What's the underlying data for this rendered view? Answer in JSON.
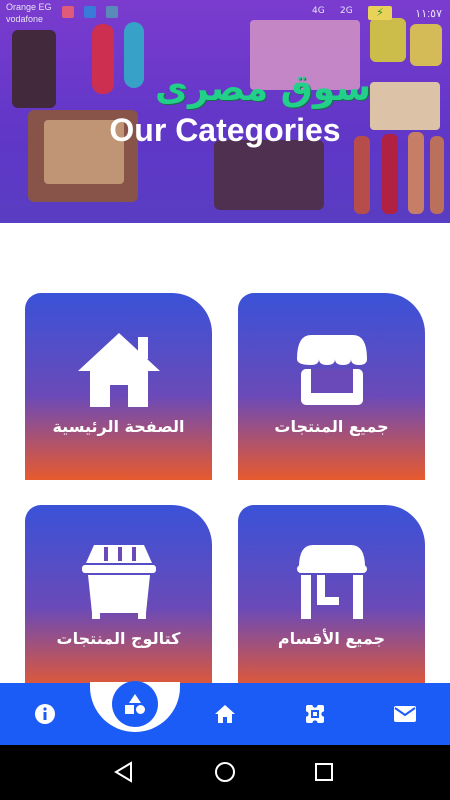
{
  "status_bar": {
    "carrier_primary": "Orange EG",
    "carrier_secondary": "vodafone",
    "time": "١١:٥٧",
    "network_1": "4G",
    "network_2": "2G"
  },
  "banner": {
    "brand_arabic": "سوق مصرى",
    "title": "Our Categories"
  },
  "categories": [
    {
      "label": "جميع المنتجات",
      "icon": "store-icon"
    },
    {
      "label": "الصفحة الرئيسية",
      "icon": "home-icon"
    },
    {
      "label": "جميع الأقسام",
      "icon": "shop-front-icon"
    },
    {
      "label": "كتالوج المنتجات",
      "icon": "catalog-bin-icon"
    }
  ],
  "bottom_nav": {
    "items": [
      "info-icon",
      "shapes-icon",
      "home-icon",
      "puzzle-icon",
      "mail-icon"
    ],
    "active": "shapes-icon"
  },
  "colors": {
    "accent": "#1c5cf6",
    "card_top": "#3a52d8",
    "card_bottom": "#e85a2e",
    "banner": "#5d39c8",
    "brand_green": "#22d08a"
  }
}
